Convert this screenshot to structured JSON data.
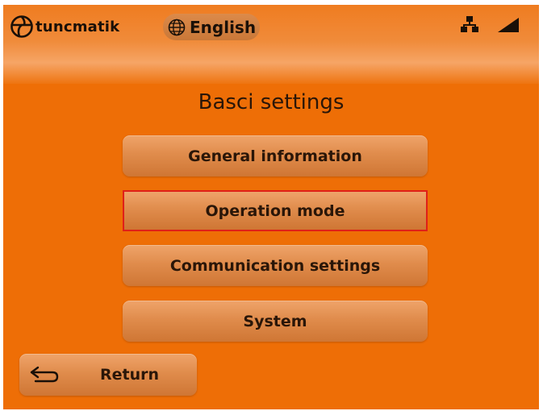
{
  "header": {
    "logo_text": "tuncmatik",
    "language": "English"
  },
  "page": {
    "title": "Basci settings"
  },
  "menu": {
    "items": [
      {
        "label": "General information",
        "selected": false
      },
      {
        "label": "Operation mode",
        "selected": true
      },
      {
        "label": "Communication settings",
        "selected": false
      },
      {
        "label": "System",
        "selected": false
      }
    ]
  },
  "footer": {
    "return_label": "Return"
  },
  "colors": {
    "background": "#ee6e06",
    "button": "#e08c4c",
    "selection_border": "#e02018",
    "text": "#2a1608"
  },
  "icons": {
    "logo": "tuncmatik-logo-icon",
    "language": "globe-icon",
    "network": "network-icon",
    "signal": "signal-strength-icon",
    "return": "return-arrow-icon"
  }
}
